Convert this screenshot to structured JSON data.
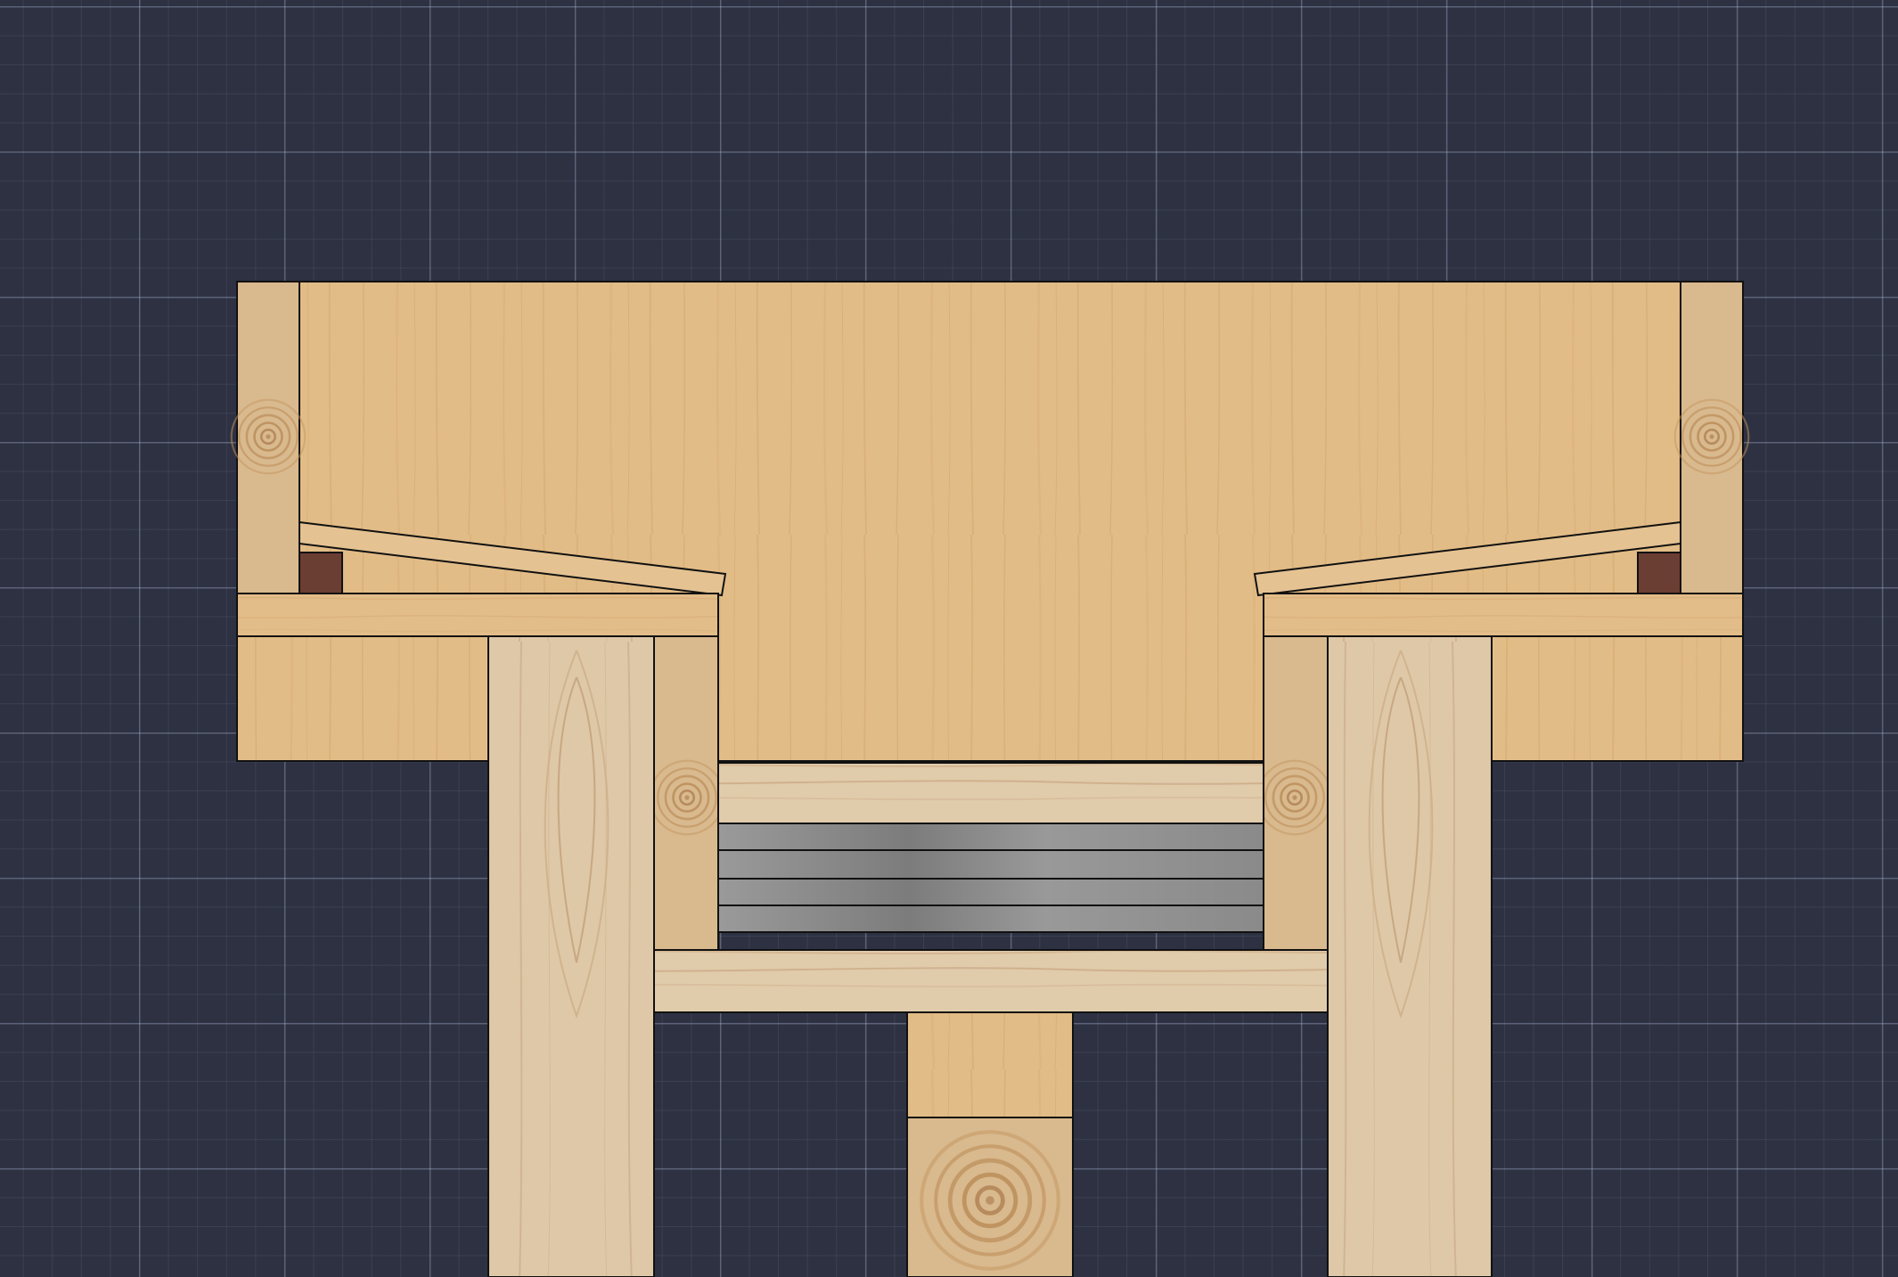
{
  "canvas": {
    "background": "#2d3142",
    "grid": true
  },
  "materials": {
    "plywood": "#e2bc86",
    "softwood": "#ddc7a6",
    "endgrain": "#d9b98e",
    "steel": "#8d8d8d",
    "rubber_pad": "#6a3e32",
    "outline": "#111111"
  },
  "parts": [
    "top-panel",
    "end-grain-post-left",
    "end-grain-post-right",
    "tilted-shim-left",
    "tilted-shim-right",
    "rubber-block-left",
    "rubber-block-right",
    "shelf-board-left",
    "shelf-board-right",
    "leg-left",
    "leg-right",
    "inner-post-left",
    "inner-post-right",
    "upper-crossbar",
    "steel-plate-stack",
    "lower-crossbar",
    "center-support-block",
    "center-post"
  ]
}
